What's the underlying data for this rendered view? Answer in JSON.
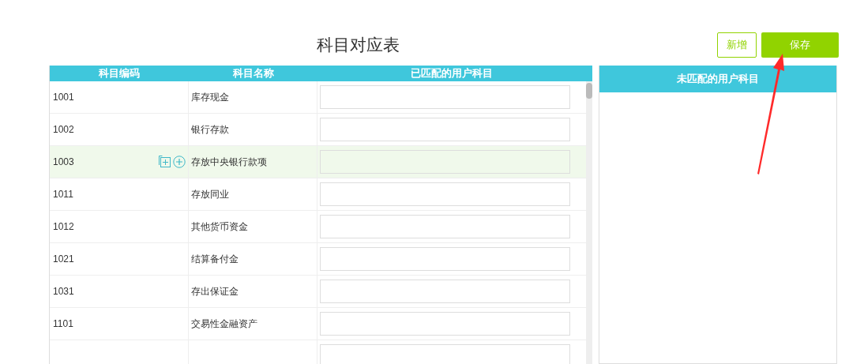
{
  "title": "科目对应表",
  "buttons": [
    {
      "label": "新增",
      "kind": "outline"
    },
    {
      "label": "保存",
      "kind": "primary"
    }
  ],
  "table": {
    "columns": [
      "科目编码",
      "科目名称",
      "已匹配的用户科目"
    ],
    "rows": [
      {
        "code": "1001",
        "name": "库存现金",
        "selected": false
      },
      {
        "code": "1002",
        "name": "银行存款",
        "selected": false
      },
      {
        "code": "1003",
        "name": "存放中央银行款项",
        "selected": true
      },
      {
        "code": "1011",
        "name": "存放同业",
        "selected": false
      },
      {
        "code": "1012",
        "name": "其他货币资金",
        "selected": false
      },
      {
        "code": "1021",
        "name": "结算备付金",
        "selected": false
      },
      {
        "code": "1031",
        "name": "存出保证金",
        "selected": false
      },
      {
        "code": "1101",
        "name": "交易性金融资产",
        "selected": false
      },
      {
        "selected": false
      }
    ]
  },
  "unmatched_panel": {
    "title": "未匹配的用户科目"
  }
}
